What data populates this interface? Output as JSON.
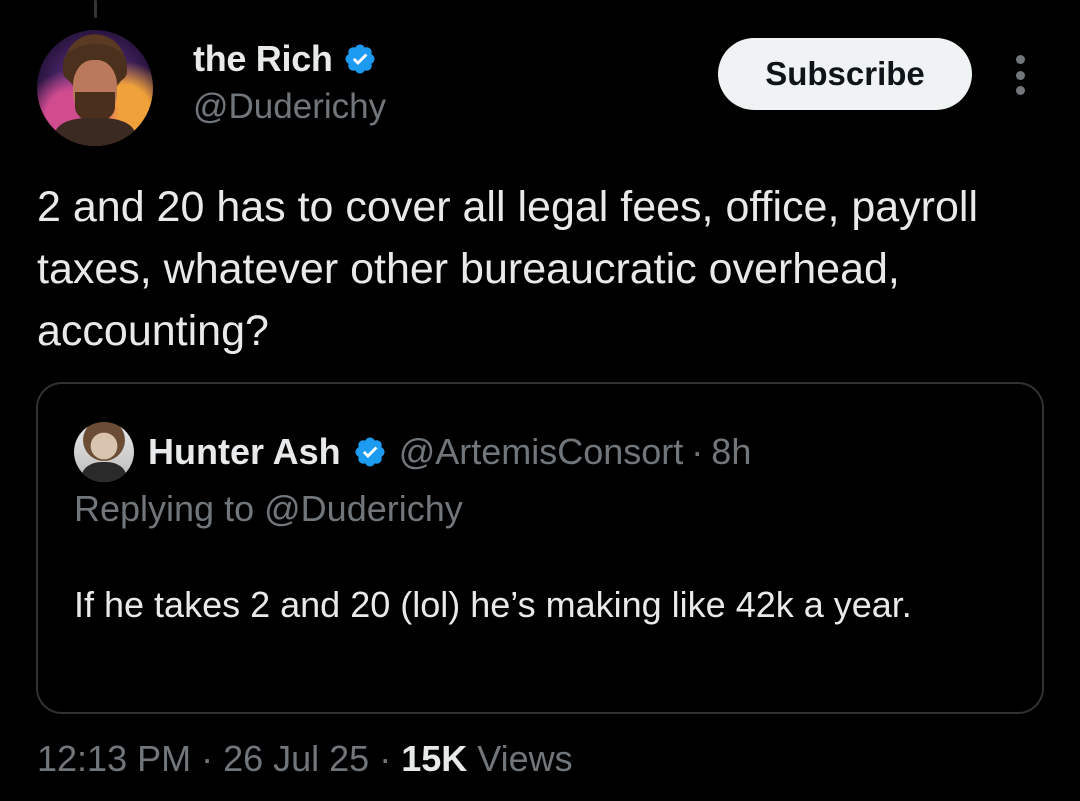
{
  "tweet": {
    "author": {
      "display_name": "the Rich",
      "handle": "@Duderichy",
      "verified": true
    },
    "subscribe_label": "Subscribe",
    "text": "2 and 20 has to cover all legal fees, office, payroll taxes, whatever other bureaucratic overhead, accounting?",
    "quote": {
      "author": {
        "display_name": "Hunter Ash",
        "handle": "@ArtemisConsort",
        "verified": true
      },
      "separator": "·",
      "time": "8h",
      "replying_prefix": "Replying to",
      "replying_to": "@Duderichy",
      "text": "If he takes 2 and 20 (lol) he’s making like 42k a year."
    },
    "meta": {
      "time": "12:13 PM",
      "separator": "·",
      "date": "26 Jul 25",
      "views_count": "15K",
      "views_label": "Views"
    }
  },
  "colors": {
    "background": "#000000",
    "text_primary": "#e7e9ea",
    "text_secondary": "#71767b",
    "verified_blue": "#1d9bf0",
    "border": "#2f3336",
    "button_bg": "#eff3f4"
  },
  "icons": {
    "verified": "verified-badge-icon",
    "more": "more-options-icon"
  }
}
